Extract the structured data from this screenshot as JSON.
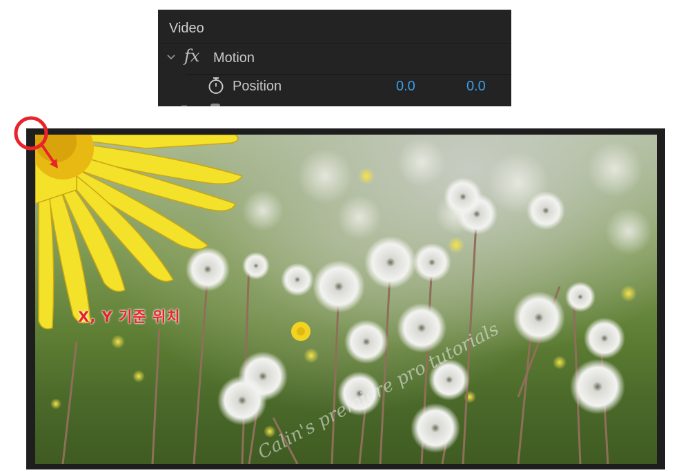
{
  "effect_controls": {
    "section": "Video",
    "effect_icon": "fx",
    "effect_name": "Motion",
    "property": {
      "name": "Position",
      "x": "0.0",
      "y": "0.0"
    }
  },
  "program_monitor": {
    "annotation": "X, Y 기준 위치",
    "watermark": "Calin's premiere pro tutorials"
  },
  "colors": {
    "panel_bg": "#232323",
    "value_blue": "#3a9ee8",
    "annotation_red": "#e8242a"
  }
}
